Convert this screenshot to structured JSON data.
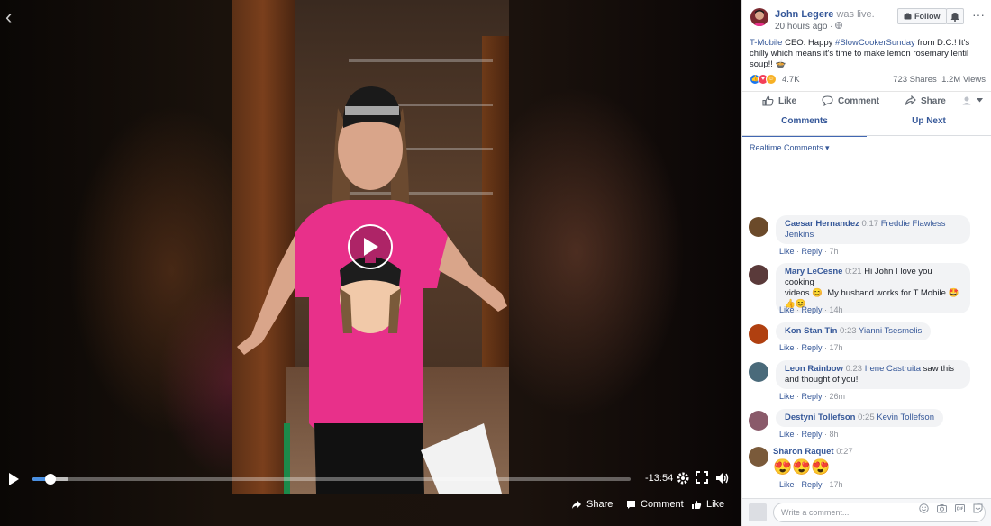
{
  "video": {
    "time_remaining": "-13:54",
    "progress_fraction": 0.03,
    "buffer_fraction": 0.06,
    "actions": {
      "share": "Share",
      "comment": "Comment",
      "like": "Like"
    }
  },
  "post": {
    "author": "John Legere",
    "status": "was live.",
    "time_ago": "20 hours ago · ",
    "follow_label": "Follow",
    "more": "···",
    "caption": {
      "brand_link": "T-Mobile",
      "text1": " CEO: Happy ",
      "hashtag": "#SlowCookerSunday",
      "text2": " from D.C.! It's chilly which means it's time to make lemon rosemary lentil soup!! 🍲"
    },
    "reactions_count": "4.7K",
    "shares": "723 Shares",
    "views": "1.2M Views",
    "actions": {
      "like": "Like",
      "comment": "Comment",
      "share": "Share"
    },
    "tabs": {
      "comments": "Comments",
      "up_next": "Up Next"
    },
    "realtime_label": "Realtime Comments ▾"
  },
  "comments": [
    {
      "name": "Caesar Hernandez",
      "time": "0:17",
      "tag": "Freddie Flawless",
      "tag2": "Jenkins",
      "text": "",
      "age": "7h",
      "color": "#6b4a2a"
    },
    {
      "name": "Mary LeCesne",
      "time": "0:21",
      "text1": "Hi John I love you cooking",
      "text2": "videos 😊. My husband works for T Mobile 🤩",
      "text3": "👍😊",
      "age": "14h",
      "color": "#5a3a3a"
    },
    {
      "name": "Kon Stan Tin",
      "time": "0:23",
      "tag": "Yianni Tsesmelis",
      "age": "17h",
      "color": "#b04010"
    },
    {
      "name": "Leon Rainbow",
      "time": "0:23",
      "tag": "Irene Castruita",
      "text1": " saw this",
      "text2": "and thought of you!",
      "age": "26m",
      "color": "#4a6a7a"
    },
    {
      "name": "Destyni Tollefson",
      "time": "0:25",
      "tag": "Kevin Tollefson",
      "age": "8h",
      "color": "#8a5a6a"
    },
    {
      "name": "Sharon Raquet",
      "time": "0:27",
      "emoji": "😍😍😍",
      "age": "17h",
      "color": "#7a5a3a"
    }
  ],
  "comment_meta": {
    "like": "Like",
    "reply": "Reply",
    "dot": " · "
  },
  "composer": {
    "placeholder": "Write a comment..."
  }
}
